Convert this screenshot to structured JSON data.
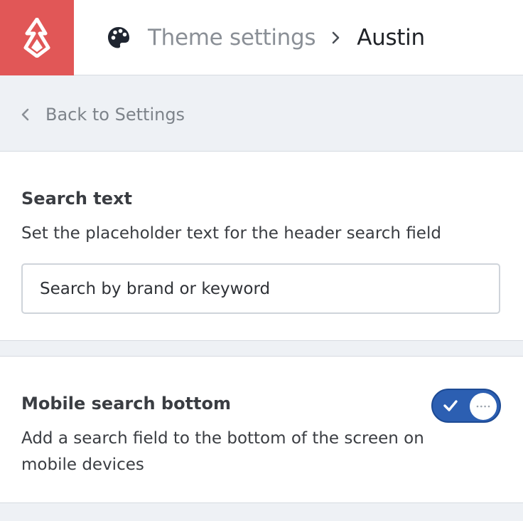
{
  "header": {
    "logo_icon": "lightspeed-flame-icon",
    "brand_color": "#e15757",
    "breadcrumb": {
      "icon": "palette-icon",
      "parent": "Theme settings",
      "separator_icon": "chevron-right-icon",
      "current": "Austin"
    }
  },
  "nav": {
    "back_icon": "chevron-left-icon",
    "back_label": "Back to Settings"
  },
  "search_section": {
    "title": "Search text",
    "description": "Set the placeholder text for the header search field",
    "input_value": "Search by brand or keyword"
  },
  "mobile_section": {
    "title": "Mobile search bottom",
    "description": "Add a search field to the bottom of the screen on mobile devices",
    "toggle_on": true,
    "toggle_color": "#2c5fb2"
  }
}
